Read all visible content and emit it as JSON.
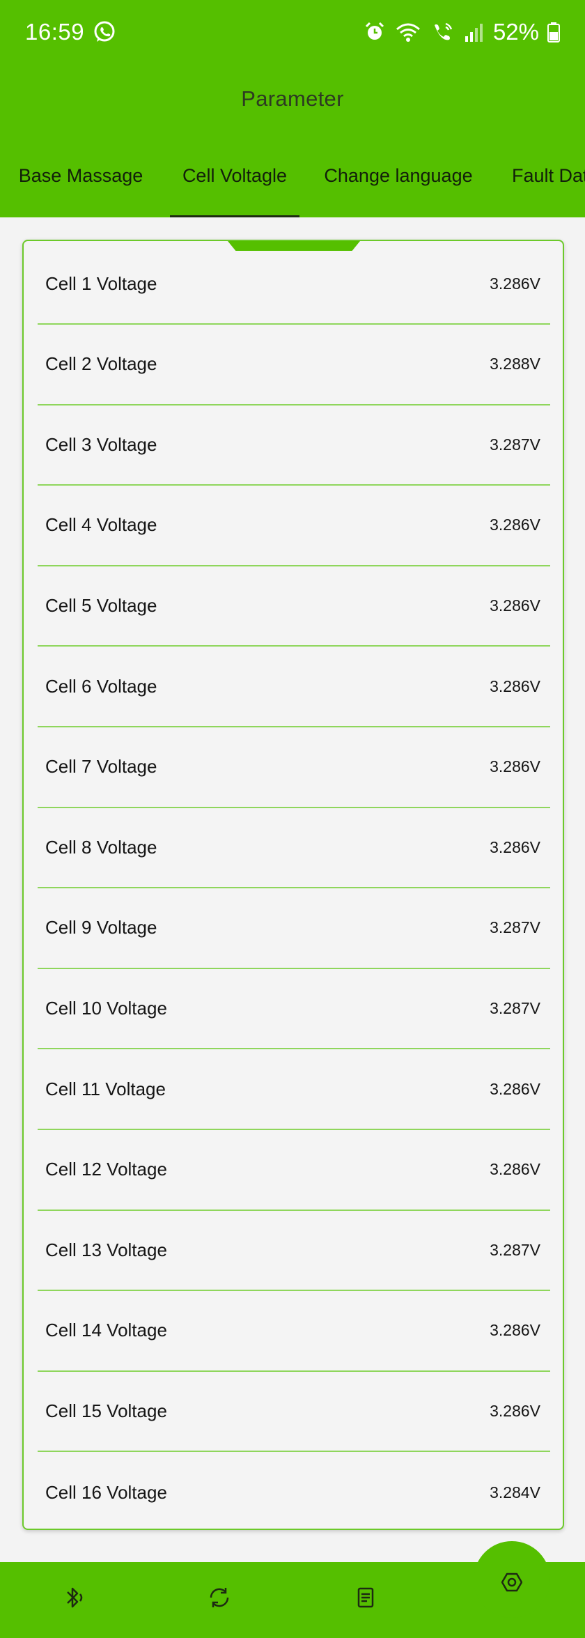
{
  "status_bar": {
    "time": "16:59",
    "battery_text": "52%",
    "icons": [
      "whatsapp-icon",
      "alarm-icon",
      "wifi-icon",
      "wifi-calling-icon",
      "signal-icon",
      "battery-icon"
    ]
  },
  "header": {
    "title": "Parameter"
  },
  "tabs": [
    {
      "label": "Base Massage",
      "active": false
    },
    {
      "label": "Cell Voltagle",
      "active": true
    },
    {
      "label": "Change language",
      "active": false
    },
    {
      "label": "Fault Dat",
      "active": false
    }
  ],
  "cells": [
    {
      "label": "Cell 1 Voltage",
      "value": "3.286V"
    },
    {
      "label": "Cell 2 Voltage",
      "value": "3.288V"
    },
    {
      "label": "Cell 3 Voltage",
      "value": "3.287V"
    },
    {
      "label": "Cell 4 Voltage",
      "value": "3.286V"
    },
    {
      "label": "Cell 5 Voltage",
      "value": "3.286V"
    },
    {
      "label": "Cell 6 Voltage",
      "value": "3.286V"
    },
    {
      "label": "Cell 7 Voltage",
      "value": "3.286V"
    },
    {
      "label": "Cell 8 Voltage",
      "value": "3.286V"
    },
    {
      "label": "Cell 9 Voltage",
      "value": "3.287V"
    },
    {
      "label": "Cell 10 Voltage",
      "value": "3.287V"
    },
    {
      "label": "Cell 11 Voltage",
      "value": "3.286V"
    },
    {
      "label": "Cell 12 Voltage",
      "value": "3.286V"
    },
    {
      "label": "Cell 13 Voltage",
      "value": "3.287V"
    },
    {
      "label": "Cell 14 Voltage",
      "value": "3.286V"
    },
    {
      "label": "Cell 15 Voltage",
      "value": "3.286V"
    },
    {
      "label": "Cell 16 Voltage",
      "value": "3.284V"
    }
  ],
  "bottom_nav": {
    "items": [
      "bluetooth-icon",
      "sync-icon",
      "document-icon"
    ],
    "fab_icon": "settings-hexagon-icon"
  },
  "colors": {
    "brand_green": "#55bf00",
    "divider_green": "#8fd65c",
    "background": "#f3f3f3"
  }
}
